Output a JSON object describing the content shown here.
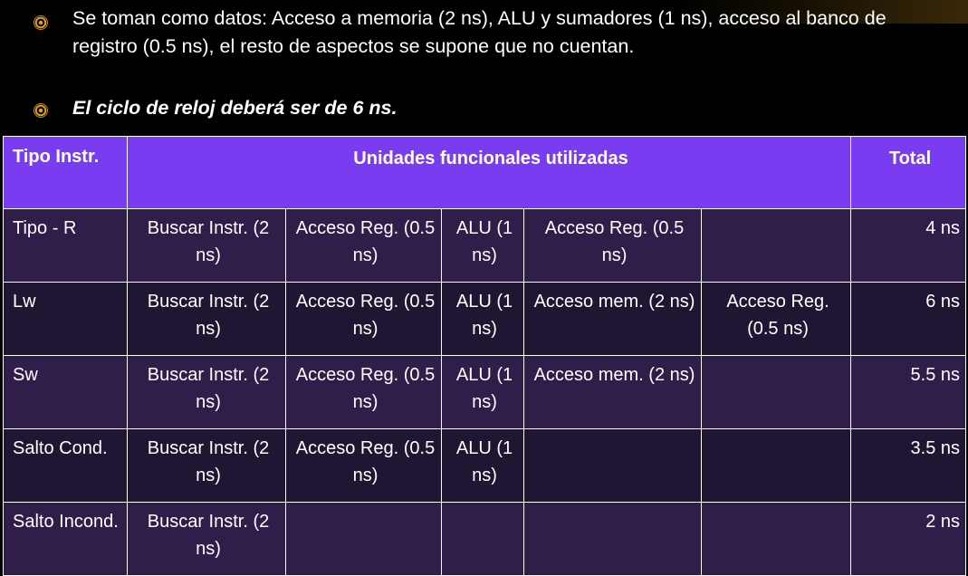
{
  "bullets": [
    {
      "text": "Se toman como datos: Acceso a memoria (2 ns), ALU y sumadores (1 ns), acceso al banco de registro (0.5 ns), el resto de aspectos se supone que no cuentan.",
      "icon": "circle-bullet-icon"
    },
    {
      "text": "El ciclo de reloj deberá ser de 6 ns.",
      "icon": "circle-bullet-icon"
    }
  ],
  "table": {
    "headers": {
      "type": "Tipo Instr.",
      "units": "Unidades funcionales utilizadas",
      "total": "Total"
    },
    "rows": [
      {
        "type": "Tipo - R",
        "units": [
          "Buscar Instr. (2 ns)",
          "Acceso Reg. (0.5 ns)",
          "ALU (1 ns)",
          "Acceso Reg. (0.5 ns)",
          ""
        ],
        "total": "4 ns"
      },
      {
        "type": "Lw",
        "units": [
          "Buscar Instr. (2 ns)",
          "Acceso Reg. (0.5 ns)",
          "ALU (1 ns)",
          "Acceso mem. (2 ns)",
          "Acceso Reg. (0.5 ns)"
        ],
        "total": "6 ns"
      },
      {
        "type": "Sw",
        "units": [
          "Buscar Instr. (2 ns)",
          "Acceso Reg. (0.5 ns)",
          "ALU (1 ns)",
          "Acceso mem. (2 ns)",
          ""
        ],
        "total": "5.5 ns"
      },
      {
        "type": "Salto Cond.",
        "units": [
          "Buscar Instr. (2 ns)",
          "Acceso Reg. (0.5 ns)",
          "ALU (1 ns)",
          "",
          ""
        ],
        "total": "3.5 ns"
      },
      {
        "type": "Salto Incond.",
        "units": [
          "Buscar Instr. (2 ns)",
          "",
          "",
          "",
          ""
        ],
        "total": "2 ns"
      }
    ]
  },
  "colors": {
    "header_bg": "#7a3cf0",
    "row_odd_bg": "#2f1e4a",
    "row_even_bg": "#1f1633",
    "bullet_accent": "#e0a020",
    "page_bg": "#000000"
  }
}
